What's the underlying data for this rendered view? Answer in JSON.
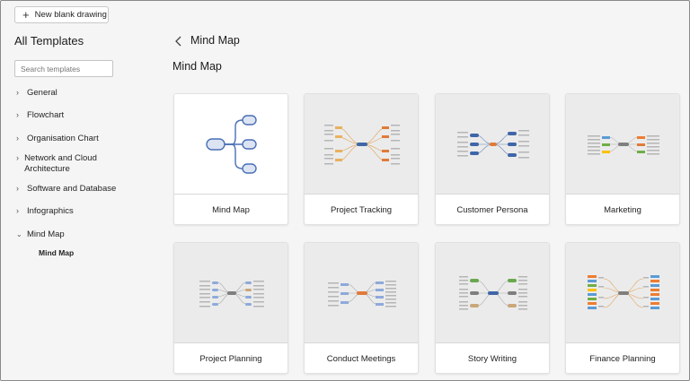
{
  "toolbar": {
    "new_label": "New blank drawing"
  },
  "sidebar": {
    "title": "All Templates",
    "search_placeholder": "Search templates",
    "items": [
      {
        "label": "General",
        "expanded": false
      },
      {
        "label": "Flowchart",
        "expanded": false
      },
      {
        "label": "Organisation Chart",
        "expanded": false
      },
      {
        "label": "Network and Cloud Architecture",
        "expanded": false
      },
      {
        "label": "Software and Database",
        "expanded": false
      },
      {
        "label": "Infographics",
        "expanded": false
      },
      {
        "label": "Mind Map",
        "expanded": true
      }
    ],
    "subitem": "Mind Map"
  },
  "main": {
    "breadcrumb": "Mind Map",
    "heading": "Mind Map",
    "cards": [
      {
        "label": "Mind Map",
        "icon": "mind-map-icon"
      },
      {
        "label": "Project Tracking"
      },
      {
        "label": "Customer Persona"
      },
      {
        "label": "Marketing"
      },
      {
        "label": "Project Planning"
      },
      {
        "label": "Conduct Meetings"
      },
      {
        "label": "Story Writing"
      },
      {
        "label": "Finance Planning"
      }
    ]
  },
  "colors": {
    "accent": "#4a6fb5",
    "thumb_bg": "#ebebeb",
    "node_orange": "#e07b39",
    "node_blue": "#3f66a8",
    "node_green": "#6aa84f"
  }
}
